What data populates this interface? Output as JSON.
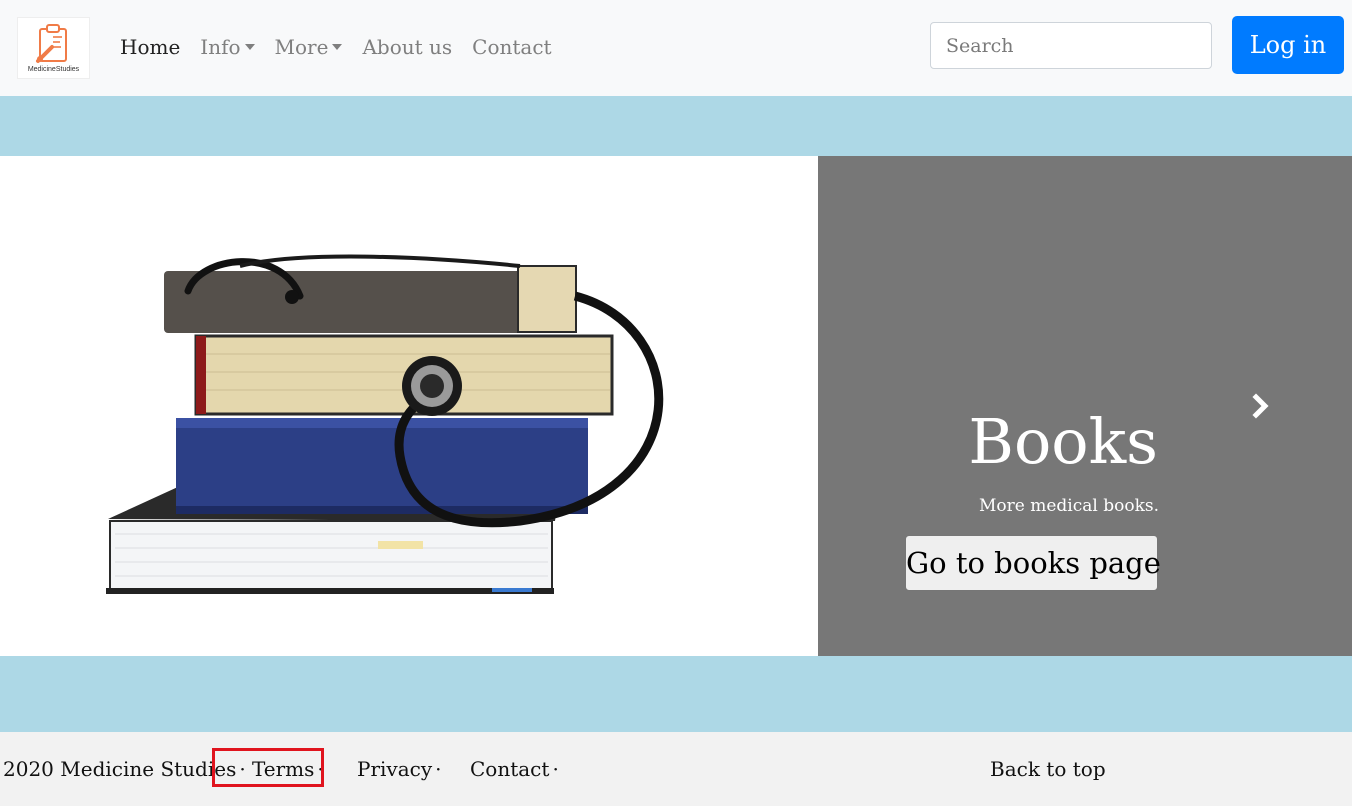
{
  "navbar": {
    "logo_text": "MedicineStudies",
    "links": [
      {
        "label": "Home",
        "active": true,
        "dropdown": false
      },
      {
        "label": "Info",
        "active": false,
        "dropdown": true
      },
      {
        "label": "More",
        "active": false,
        "dropdown": true
      },
      {
        "label": "About us",
        "active": false,
        "dropdown": false
      },
      {
        "label": "Contact",
        "active": false,
        "dropdown": false
      }
    ],
    "search_placeholder": "Search",
    "login_label": "Log in"
  },
  "carousel": {
    "slide_image": "books-with-stethoscope",
    "caption_title": "Books",
    "caption_text": "More medical books.",
    "button_label": "Go to books page",
    "next_icon": "chevron-right-icon"
  },
  "footer": {
    "copyright": "2020 Medicine Studies",
    "separator": "·",
    "terms": "Terms",
    "privacy": "Privacy",
    "contact": "Contact",
    "back_to_top": "Back to top"
  },
  "colors": {
    "primary": "#007bff",
    "band": "#add8e6",
    "carousel_bg": "#777777",
    "highlight": "#e0141e"
  }
}
